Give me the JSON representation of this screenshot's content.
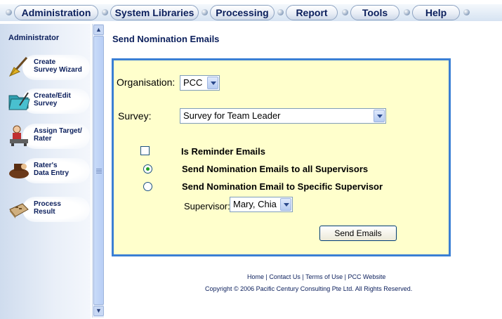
{
  "menu": {
    "items": [
      {
        "label": "Administration"
      },
      {
        "label": "System Libraries"
      },
      {
        "label": "Processing"
      },
      {
        "label": "Report"
      },
      {
        "label": "Tools"
      },
      {
        "label": "Help"
      }
    ]
  },
  "sidebar": {
    "title": "Administrator",
    "items": [
      {
        "label": "Create\nSurvey Wizard",
        "icon": "wizard-broom-icon"
      },
      {
        "label": "Create/Edit\nSurvey",
        "icon": "folder-edit-icon"
      },
      {
        "label": "Assign Target/\nRater",
        "icon": "person-assign-icon"
      },
      {
        "label": "Rater's\nData Entry",
        "icon": "data-entry-icon"
      },
      {
        "label": "Process\nResult",
        "icon": "calculator-icon"
      }
    ]
  },
  "page": {
    "title": "Send Nomination Emails"
  },
  "form": {
    "organisation_label": "Organisation:",
    "organisation_value": "PCC",
    "survey_label": "Survey:",
    "survey_value": "Survey for Team Leader",
    "reminder_label": "Is Reminder Emails",
    "reminder_checked": false,
    "option_all_label": "Send Nomination Emails to all Supervisors",
    "option_all_selected": true,
    "option_specific_label": "Send Nomination Email to Specific Supervisor",
    "option_specific_selected": false,
    "supervisor_label": "Supervisor:",
    "supervisor_value": "Mary, Chia",
    "submit_label": "Send Emails"
  },
  "footer": {
    "links": [
      "Home",
      "Contact Us",
      "Terms of Use",
      "PCC Website"
    ],
    "separator": "|",
    "copyright": "Copyright © 2006 Pacific Century Consulting Pte Ltd. All Rights Reserved."
  },
  "colors": {
    "panel_bg": "#ffffcc",
    "panel_border": "#3a7fd4",
    "menu_text": "#0b1f5c"
  }
}
